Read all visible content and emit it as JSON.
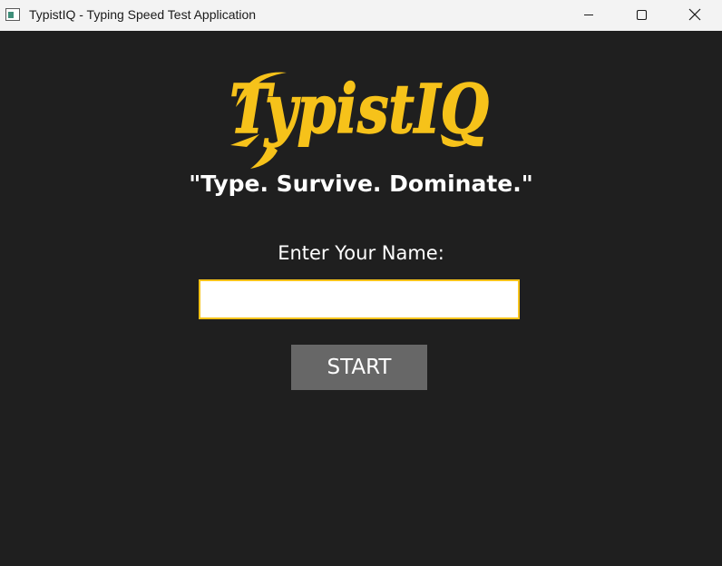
{
  "window": {
    "title": "TypistIQ - Typing Speed Test Application",
    "controls": {
      "minimize_icon": "minimize-icon",
      "maximize_icon": "maximize-icon",
      "close_icon": "close-icon"
    }
  },
  "main": {
    "logo_text": "TypistIQ",
    "tagline": "\"Type. Survive. Dominate.\"",
    "name_label": "Enter Your Name:",
    "name_input_value": "",
    "name_input_placeholder": "",
    "start_label": "START"
  },
  "colors": {
    "background": "#1f1f1f",
    "titlebar": "#f3f3f3",
    "brand_yellow": "#f6c21a",
    "button": "#676767",
    "text": "#ffffff"
  }
}
